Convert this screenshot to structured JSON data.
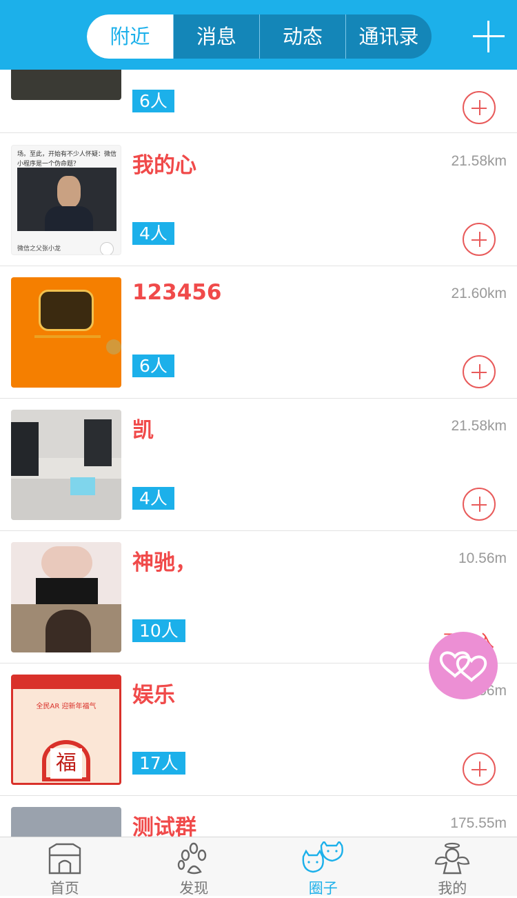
{
  "header": {
    "segments": [
      {
        "label": "附近",
        "active": true
      },
      {
        "label": "消息",
        "active": false
      },
      {
        "label": "动态",
        "active": false
      },
      {
        "label": "通讯录",
        "active": false
      }
    ],
    "plus_icon": "plus-icon"
  },
  "groups": [
    {
      "name": "",
      "distance": "",
      "count": "6人",
      "action": "add"
    },
    {
      "name": "我的心",
      "distance": "21.58km",
      "count": "4人",
      "action": "add",
      "thumb_text": "场。至此，开始有不少人怀疑：微信小程序是一个伪命题？",
      "thumb_caption": "微信之父张小龙"
    },
    {
      "name": "123456",
      "distance": "21.60km",
      "count": "6人",
      "action": "add"
    },
    {
      "name": "凯",
      "distance": "21.58km",
      "count": "4人",
      "action": "add"
    },
    {
      "name": "神驰，",
      "distance": "10.56m",
      "count": "10人",
      "action": "partial",
      "partial_text": "已加入"
    },
    {
      "name": "娱乐",
      "distance": "56m",
      "count": "17人",
      "action": "add",
      "thumb_band": "在一起 过福年",
      "thumb_line": "全民AR 迎新年福气",
      "thumb_char": "福"
    },
    {
      "name": "测试群",
      "distance": "175.55m",
      "count": "",
      "action": "none"
    }
  ],
  "fab": {
    "icon": "double-heart-icon",
    "color": "#ec8fd4"
  },
  "tabs": [
    {
      "label": "首页",
      "icon": "home-icon",
      "active": false
    },
    {
      "label": "发现",
      "icon": "paw-icon",
      "active": false
    },
    {
      "label": "圈子",
      "icon": "cat-pair-icon",
      "active": true
    },
    {
      "label": "我的",
      "icon": "angel-icon",
      "active": false
    }
  ],
  "colors": {
    "brand": "#1cb0ea",
    "accent": "#f04a4a"
  }
}
